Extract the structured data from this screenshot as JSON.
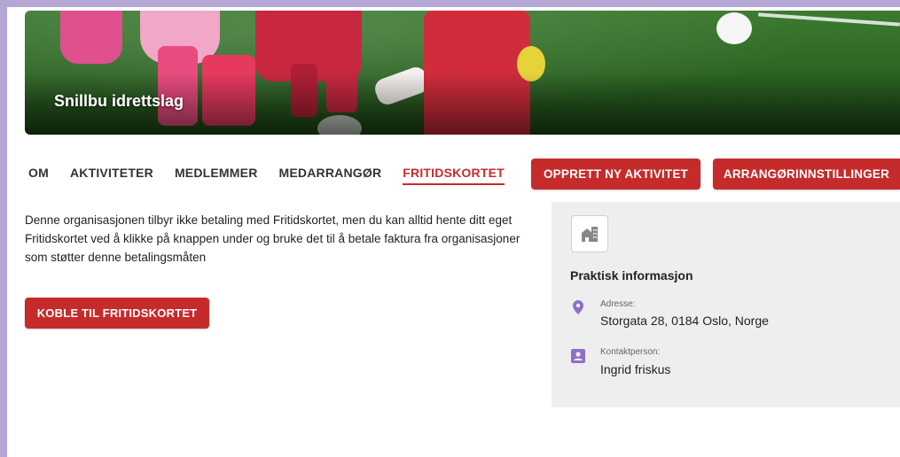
{
  "hero": {
    "title": "Snillbu idrettslag"
  },
  "nav": {
    "tabs": [
      {
        "label": "OM"
      },
      {
        "label": "AKTIVITETER"
      },
      {
        "label": "MEDLEMMER"
      },
      {
        "label": "MEDARRANGØR"
      },
      {
        "label": "FRITIDSKORTET",
        "active": true
      }
    ]
  },
  "actions": {
    "new_activity": "OPPRETT NY AKTIVITET",
    "organizer_settings": "ARRANGØRINNSTILLINGER"
  },
  "main": {
    "description": "Denne organisasjonen tilbyr ikke betaling med Fritidskortet, men du kan alltid hente ditt eget Fritidskortet ved å klikke på knappen under og bruke det til å betale faktura fra organisasjoner som støtter denne betalingsmåten",
    "connect_button": "KOBLE TIL FRITIDSKORTET"
  },
  "info": {
    "title": "Praktisk informasjon",
    "address_label": "Adresse:",
    "address_value": "Storgata 28, 0184 Oslo, Norge",
    "contact_label": "Kontaktperson:",
    "contact_value": "Ingrid friskus"
  },
  "colors": {
    "accent": "#c62b2b",
    "icon_purple": "#8e6fc7",
    "frame": "#b4a7d6",
    "panel_bg": "#eeeeee"
  },
  "icons": {
    "location": "location-pin-icon",
    "contact": "contact-card-icon",
    "logo": "building-icon"
  }
}
